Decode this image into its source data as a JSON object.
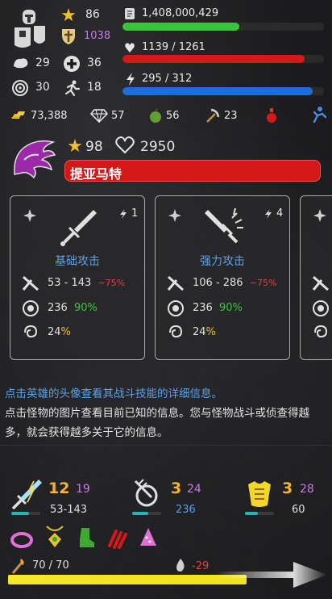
{
  "hero": {
    "level": "86",
    "might": "1038",
    "strength": "29",
    "health_stat": "36",
    "accuracy": "30",
    "speed": "18",
    "experience": "1,408,000,429",
    "experience_fraction": 0.58,
    "hp": "1139 / 1261",
    "hp_fraction": 0.903,
    "energy": "295 / 312",
    "energy_fraction": 0.945
  },
  "resources": {
    "gold": "73,388",
    "diamonds": "57",
    "apples": "56",
    "pickaxes": "23"
  },
  "monster": {
    "stars": "98",
    "hearts": "2950",
    "name": "提亚马特"
  },
  "skills": [
    {
      "name": "基础攻击",
      "energy_cost": "1",
      "damage": "53 - 143",
      "damage_mod": "−75%",
      "accuracy": "236",
      "accuracy_mod": "90%",
      "crit": "24",
      "crit_mod": "%"
    },
    {
      "name": "强力攻击",
      "energy_cost": "4",
      "damage": "106 - 286",
      "damage_mod": "−75%",
      "accuracy": "236",
      "accuracy_mod": "90%",
      "crit": "24",
      "crit_mod": "%"
    }
  ],
  "info": {
    "line1": "点击英雄的头像查看其战斗技能的详细信息。",
    "line2": "点击怪物的图片查看目前已知的信息。您与怪物战斗或侦查得越多，就会获得越多关于它的信息。"
  },
  "equipment": {
    "weapon": {
      "level": "12",
      "bonus": "19",
      "value": "53-143"
    },
    "shield": {
      "level": "3",
      "bonus": "24",
      "value": "236"
    },
    "armor": {
      "level": "3",
      "bonus": "28",
      "value": "60"
    }
  },
  "bottom": {
    "stamina": "70 / 70",
    "stamina_fraction": 1.0,
    "fire_value": "-29"
  },
  "colors": {
    "xp_bar": "#3bc43b",
    "hp_bar": "#d81818",
    "energy_bar": "#1e6ed8",
    "skill_name": "#5aa0ea",
    "stamina_bar": "#f2e21a"
  }
}
